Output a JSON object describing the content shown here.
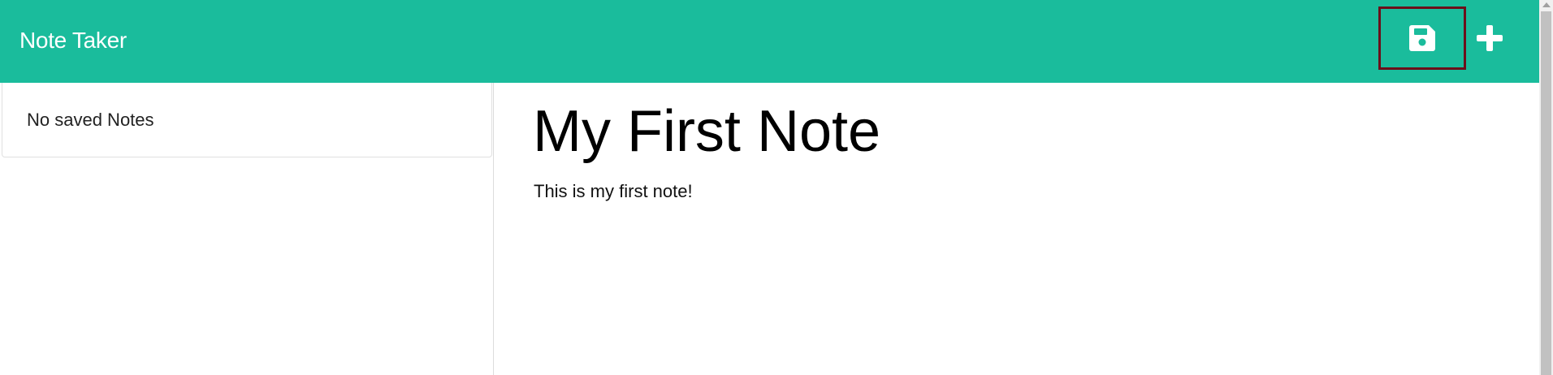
{
  "navbar": {
    "brand": "Note Taker",
    "background_color": "#1abc9c",
    "save_icon": "floppy-disk-icon",
    "new_icon": "plus-icon",
    "highlight_color": "#6b0f1a"
  },
  "sidebar": {
    "items": [
      {
        "label": "No saved Notes"
      }
    ]
  },
  "editor": {
    "title": "My First Note",
    "text": "This is my first note!"
  }
}
